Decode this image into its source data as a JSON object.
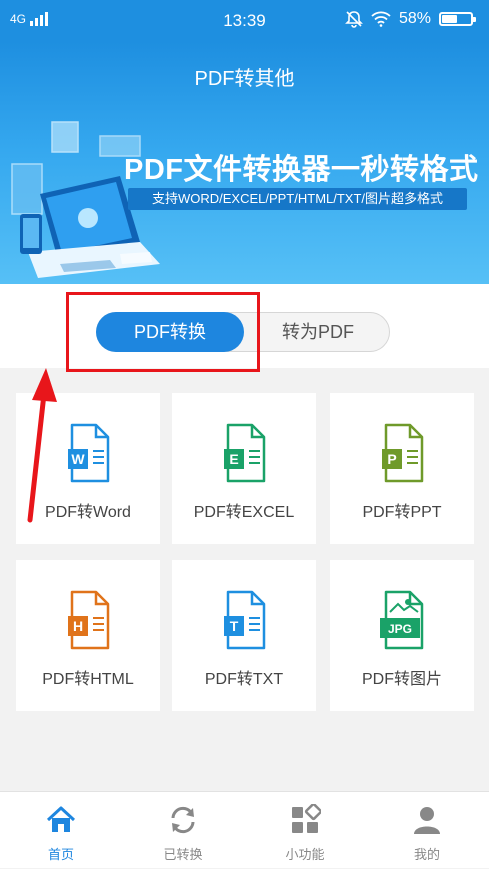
{
  "status_bar": {
    "network": "4G",
    "time": "13:39",
    "battery": "58%",
    "battery_level": 0.58
  },
  "header": {
    "title": "PDF转其他"
  },
  "banner": {
    "headline": "PDF文件转换器一秒转格式",
    "subline": "支持WORD/EXCEL/PPT/HTML/TXT/图片超多格式"
  },
  "segment": {
    "active": "PDF转换",
    "inactive": "转为PDF"
  },
  "tools": [
    {
      "label": "PDF转Word",
      "letter": "W",
      "color": "#1e8fe0"
    },
    {
      "label": "PDF转EXCEL",
      "letter": "E",
      "color": "#1aa268"
    },
    {
      "label": "PDF转PPT",
      "letter": "P",
      "color": "#6f9a2a"
    },
    {
      "label": "PDF转HTML",
      "letter": "H",
      "color": "#e0731a"
    },
    {
      "label": "PDF转TXT",
      "letter": "T",
      "color": "#1e8fe0"
    },
    {
      "label": "PDF转图片",
      "letter": "JPG",
      "color": "#1aa268"
    }
  ],
  "tabbar": {
    "items": [
      {
        "label": "首页",
        "active": true
      },
      {
        "label": "已转换"
      },
      {
        "label": "小功能"
      },
      {
        "label": "我的"
      }
    ]
  },
  "colors": {
    "primary": "#1e86df",
    "highlight": "#e8161b"
  }
}
